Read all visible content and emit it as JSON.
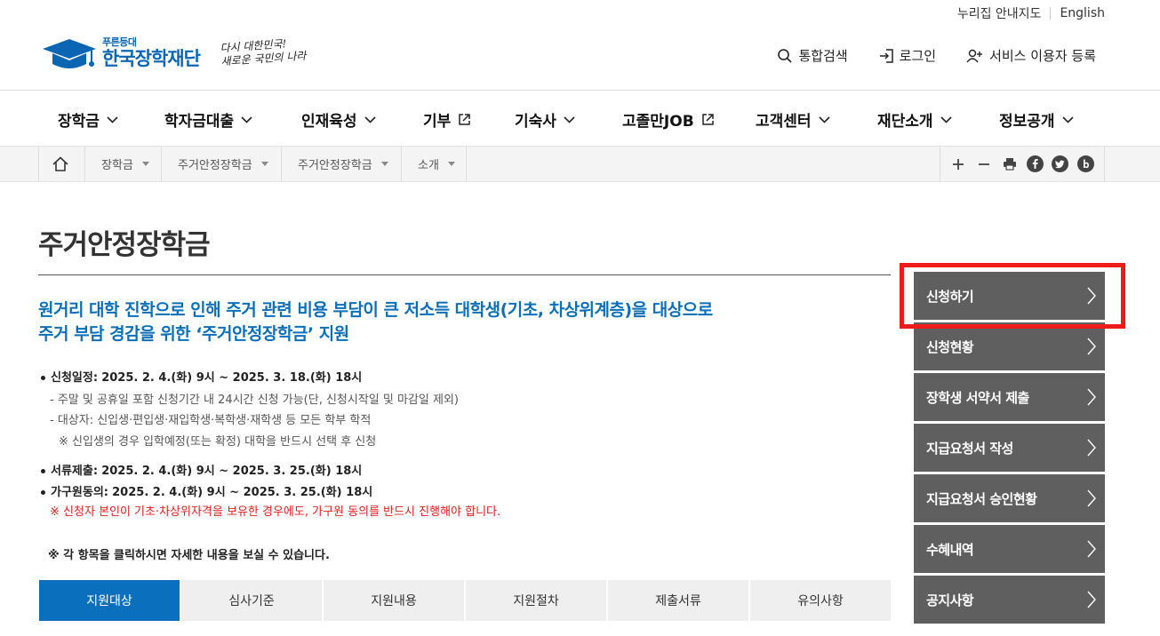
{
  "utility": {
    "guide": "누리집 안내지도",
    "english": "English"
  },
  "logo": {
    "small": "푸른등대",
    "name": "한국장학재단",
    "slogan_line1": "다시 대한민국!",
    "slogan_line2": "새로운 국민의 나라"
  },
  "header_actions": {
    "search": "통합검색",
    "login": "로그인",
    "register": "서비스 이용자 등록"
  },
  "gnb": [
    {
      "label": "장학금",
      "icon": "chevron-down-icon"
    },
    {
      "label": "학자금대출",
      "icon": "chevron-down-icon"
    },
    {
      "label": "인재육성",
      "icon": "chevron-down-icon"
    },
    {
      "label": "기부",
      "icon": "external-link-icon"
    },
    {
      "label": "기숙사",
      "icon": "chevron-down-icon"
    },
    {
      "label": "고졸만JOB",
      "icon": "external-link-icon"
    },
    {
      "label": "고객센터",
      "icon": "chevron-down-icon"
    },
    {
      "label": "재단소개",
      "icon": "chevron-down-icon"
    },
    {
      "label": "정보공개",
      "icon": "chevron-down-icon"
    }
  ],
  "breadcrumb": [
    "장학금",
    "주거안정장학금",
    "주거안정장학금",
    "소개"
  ],
  "page_title": "주거안정장학금",
  "lead": {
    "line1": "원거리 대학 진학으로 인해 주거 관련 비용 부담이 큰 저소득 대학생(기초, 차상위계층)을 대상으로",
    "line2": "주거 부담 경감을 위한 ‘주거안정장학금’ 지원"
  },
  "info": {
    "apply_label": "신청일정:",
    "apply_value": "2025. 2. 4.(화) 9시 ~ 2025. 3. 18.(화) 18시",
    "apply_sub1": "- 주말 및 공휴일 포함 신청기간 내 24시간 신청 가능(단, 신청시작일 및 마감일 제외)",
    "apply_sub2": "- 대상자: 신입생·편입생·재입학생·복학생·재학생 등 모든 학부 학적",
    "apply_sub3": "※ 신입생의 경우 입학예정(또는 확정) 대학을 반드시 선택 후 신청",
    "docs_label": "서류제출:",
    "docs_value": "2025. 2. 4.(화) 9시 ~ 2025. 3. 25.(화) 18시",
    "family_label": "가구원동의:",
    "family_value": "2025. 2. 4.(화) 9시 ~ 2025. 3. 25.(화) 18시",
    "family_warn": "※ 신청자 본인이 기초·차상위자격을 보유한 경우에도, 가구원 동의를 반드시 진행해야 합니다."
  },
  "notice": "※ 각 항목을 클릭하시면 자세한 내용을 보실 수 있습니다.",
  "tabs": [
    "지원대상",
    "심사기준",
    "지원내용",
    "지원절차",
    "제출서류",
    "유의사항"
  ],
  "side_nav": [
    "신청하기",
    "신청현황",
    "장학생 서약서 제출",
    "지급요청서 작성",
    "지급요청서 승인현황",
    "수혜내역",
    "공지사항"
  ],
  "colors": {
    "brand": "#0a66b3",
    "active_tab": "#0a70bd",
    "side_bg": "#5f5f5f",
    "highlight": "#ee1b1b",
    "warning": "#e0201f"
  }
}
